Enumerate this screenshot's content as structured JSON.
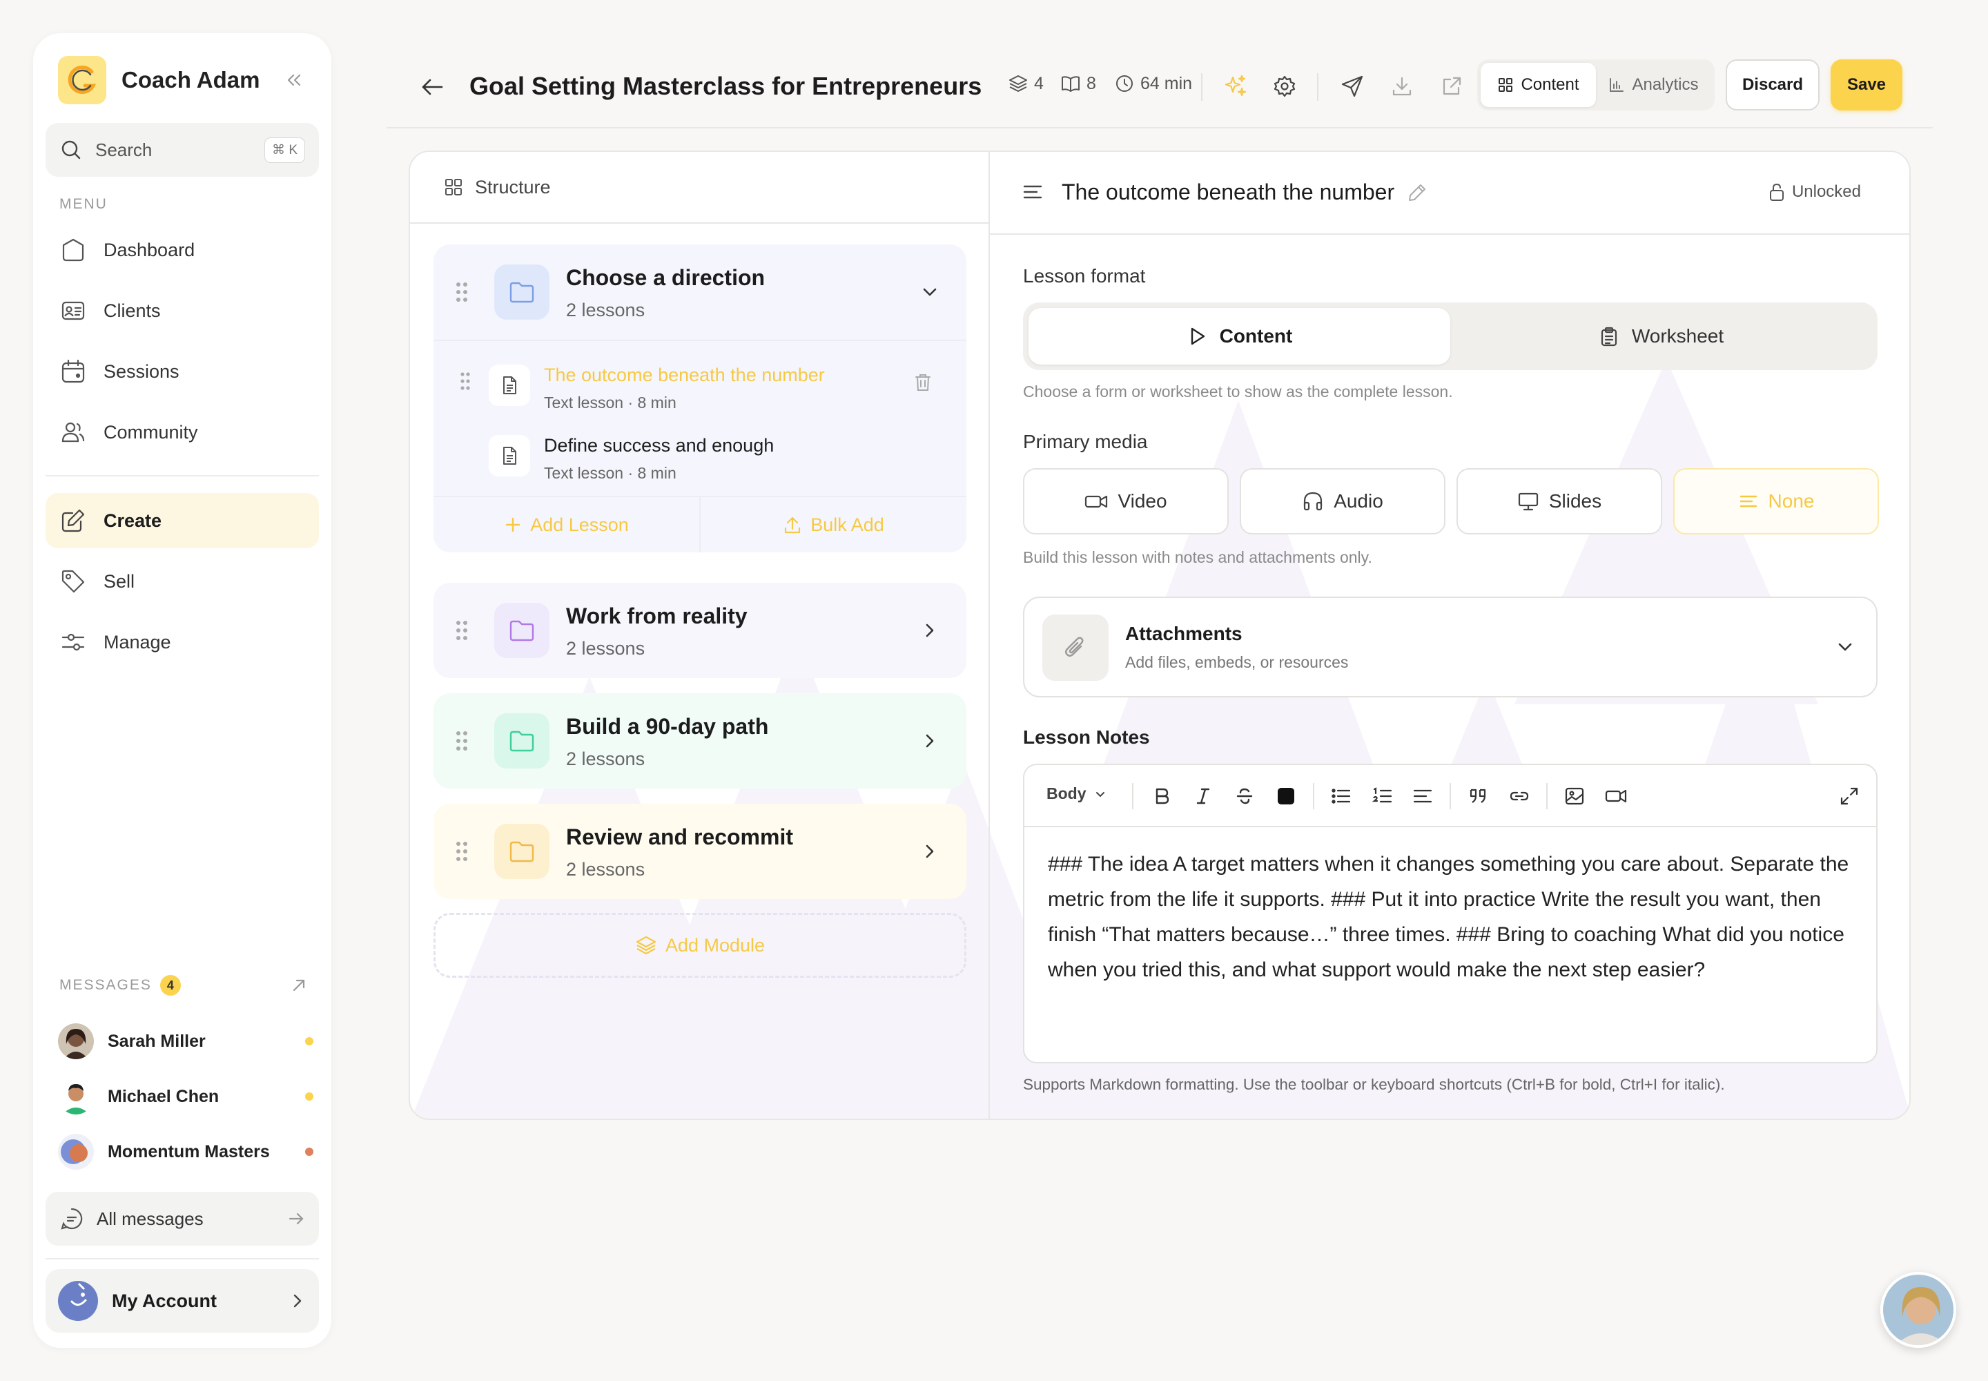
{
  "sidebar": {
    "brand": "Coach Adam",
    "search": {
      "label": "Search",
      "shortcut": "⌘ K"
    },
    "menu_label": "MENU",
    "menu": [
      {
        "label": "Dashboard",
        "icon": "dashboard-icon"
      },
      {
        "label": "Clients",
        "icon": "clients-icon"
      },
      {
        "label": "Sessions",
        "icon": "sessions-icon"
      },
      {
        "label": "Community",
        "icon": "community-icon"
      }
    ],
    "sections": [
      {
        "label": "Create",
        "icon": "edit-icon",
        "active": true
      },
      {
        "label": "Sell",
        "icon": "tag-icon"
      },
      {
        "label": "Manage",
        "icon": "sliders-icon"
      }
    ],
    "messages_label": "MESSAGES",
    "messages_count": "4",
    "messages": [
      {
        "name": "Sarah Miller",
        "dot": "#fcd34d"
      },
      {
        "name": "Michael Chen",
        "dot": "#fcd34d"
      },
      {
        "name": "Momentum Masters",
        "dot": "#e0805c"
      }
    ],
    "all_messages": "All messages",
    "account": "My Account"
  },
  "topbar": {
    "title": "Goal Setting Masterclass for Entrepreneurs",
    "stats": {
      "modules": "4",
      "lessons": "8",
      "duration": "64 min"
    },
    "tabs": [
      {
        "label": "Content",
        "active": true
      },
      {
        "label": "Analytics",
        "active": false
      }
    ],
    "discard": "Discard",
    "save": "Save"
  },
  "structure": {
    "header": "Structure",
    "modules": [
      {
        "title": "Choose a direction",
        "subtitle": "2 lessons",
        "color": "#dbeafe",
        "icon_color": "#7c9ee6",
        "expanded": true,
        "lessons": [
          {
            "title": "The outcome beneath the number",
            "meta": "Text lesson · 8 min",
            "active": true
          },
          {
            "title": "Define success and enough",
            "meta": "Text lesson · 8 min",
            "active": false
          }
        ]
      },
      {
        "title": "Work from reality",
        "subtitle": "2 lessons",
        "color": "#ede9fe",
        "icon_color": "#b07ae6"
      },
      {
        "title": "Build a 90-day path",
        "subtitle": "2 lessons",
        "color": "#d1fae5",
        "icon_color": "#3ecf9a"
      },
      {
        "title": "Review and recommit",
        "subtitle": "2 lessons",
        "color": "#fef3c7",
        "icon_color": "#f0b948"
      }
    ],
    "add_lesson": "Add Lesson",
    "bulk_add": "Bulk Add",
    "add_module": "Add Module"
  },
  "editor": {
    "title": "The outcome beneath the number",
    "lock_status": "Unlocked",
    "format_label": "Lesson format",
    "formats": [
      {
        "label": "Content",
        "active": true
      },
      {
        "label": "Worksheet",
        "active": false
      }
    ],
    "format_help": "Choose a form or worksheet to show as the complete lesson.",
    "media_label": "Primary media",
    "media": [
      {
        "label": "Video",
        "active": false
      },
      {
        "label": "Audio",
        "active": false
      },
      {
        "label": "Slides",
        "active": false
      },
      {
        "label": "None",
        "active": true
      }
    ],
    "media_help": "Build this lesson with notes and attachments only.",
    "attachments": {
      "title": "Attachments",
      "subtitle": "Add files, embeds, or resources"
    },
    "notes_label": "Lesson Notes",
    "text_style": "Body",
    "notes": "### The idea A target matters when it changes something you care about. Separate the metric from the life it supports. ### Put it into practice Write the result you want, then finish “That matters because…” three times. ### Bring to coaching What did you notice when you tried this, and what support would make the next step easier?",
    "notes_help": "Supports Markdown formatting. Use the toolbar or keyboard shortcuts (Ctrl+B for bold, Ctrl+I for italic)."
  },
  "colors": {
    "accent": "#fcd34d",
    "accent_text": "#f6c945",
    "active_nav": "#fdf6e0"
  }
}
